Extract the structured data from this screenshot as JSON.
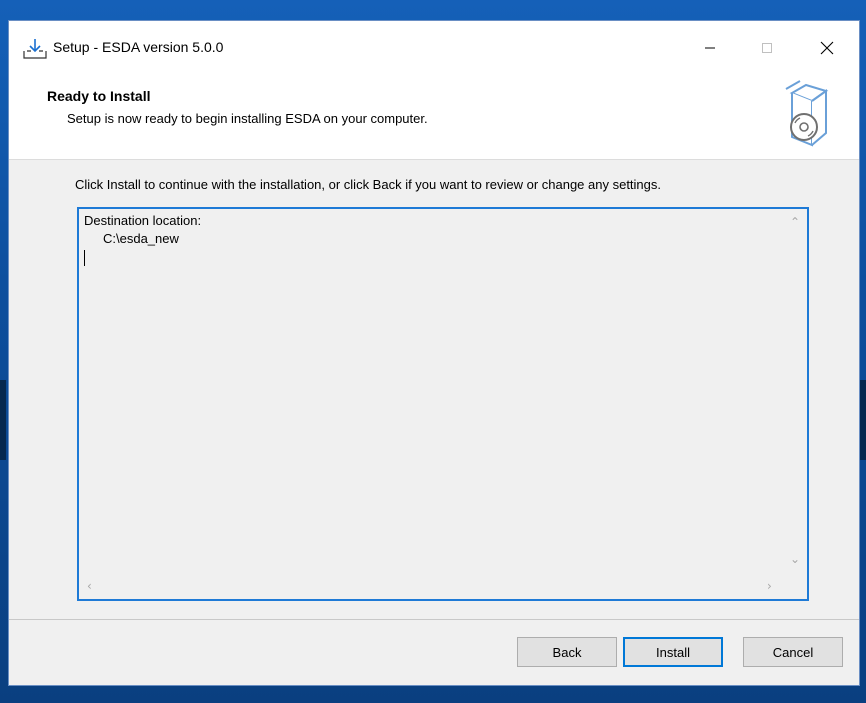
{
  "window": {
    "title": "Setup - ESDA version 5.0.0"
  },
  "header": {
    "title": "Ready to Install",
    "subtitle": "Setup is now ready to begin installing ESDA on your computer."
  },
  "main": {
    "instruction": "Click Install to continue with the installation, or click Back if you want to review or change any settings.",
    "memo_lines": [
      "Destination location:",
      "C:\\esda_new"
    ]
  },
  "buttons": {
    "back": "Back",
    "install": "Install",
    "cancel": "Cancel"
  },
  "icons": {
    "app": "install-download-icon",
    "header_image": "software-box-cd-icon"
  },
  "colors": {
    "accent": "#0078d7",
    "memo_border": "#1e7ad6"
  }
}
